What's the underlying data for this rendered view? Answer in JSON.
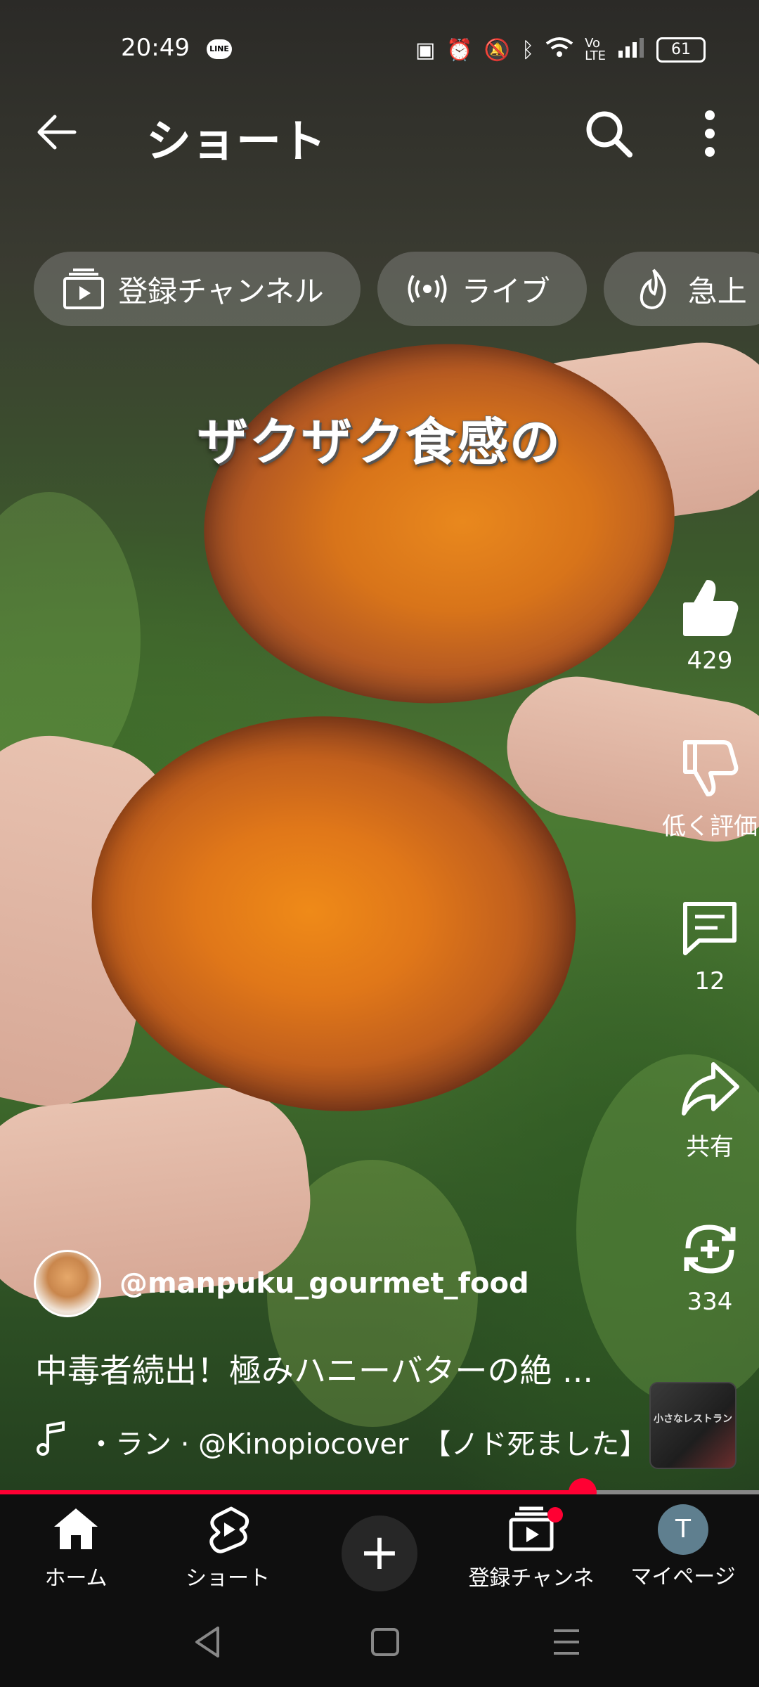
{
  "status_bar": {
    "time": "20:49",
    "line_badge": "LINE",
    "battery": "61"
  },
  "header": {
    "title": "ショート"
  },
  "chips": [
    {
      "label": "登録チャンネル",
      "icon": "subscriptions-icon"
    },
    {
      "label": "ライブ",
      "icon": "live-icon"
    },
    {
      "label": "急上",
      "icon": "trending-icon"
    }
  ],
  "video": {
    "overlay_text": "ザクザク食感の"
  },
  "actions": {
    "like_count": "429",
    "dislike_label": "低く評価",
    "comment_count": "12",
    "share_label": "共有",
    "remix_count": "334"
  },
  "channel": {
    "handle": "@manpuku_gourmet_food"
  },
  "title": "中毒者続出！極みハニーバターの絶 ...",
  "music": {
    "text": "・ラン · @Kinopiocover　【ノド死ました】"
  },
  "thumbnail_text": "小さなレストラン",
  "progress": {
    "fraction": 0.768
  },
  "nav": {
    "home": "ホーム",
    "shorts": "ショート",
    "subscriptions": "登録チャンネル",
    "mypage": "マイページ",
    "avatar_letter": "T"
  },
  "colors": {
    "accent": "#ff0033",
    "nav_bg": "#0f0f0f"
  }
}
